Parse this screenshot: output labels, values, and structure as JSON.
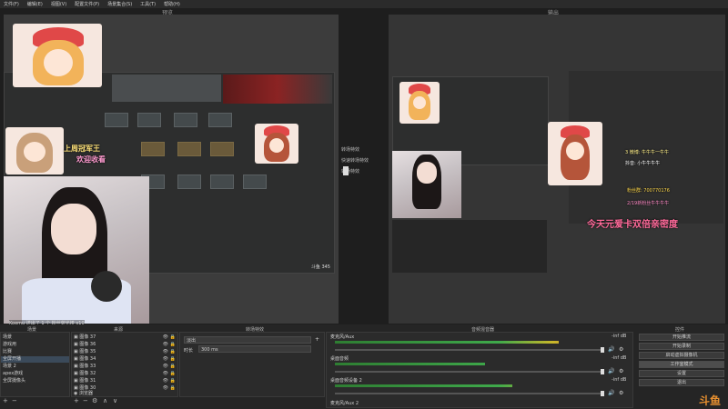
{
  "menu": [
    "文件(F)",
    "编辑(E)",
    "视图(V)",
    "配置文件(P)",
    "场景集合(S)",
    "工具(T)",
    "帮助(H)"
  ],
  "panels": {
    "preview_title": "预览",
    "output_title": "输出"
  },
  "transition_middle": {
    "btn1": "转场特效",
    "btn2": "快速转场特效",
    "btn3": "转场特效"
  },
  "overlay": {
    "sticker1": "上周冠军王",
    "sticker2": "欢迎收看",
    "output_line1": "今天元爱卡双倍亲密度",
    "weibo": "3 微博: 牛牛牛一牛牛",
    "douyin": "抖音: 小牛牛牛牛",
    "group": "粉丝群: 700770176",
    "small_text": "斗鱼 345",
    "small_text2": "2/19新粉丝牛牛牛牛"
  },
  "chat_line": "Koemu 送出了 1 个 粉丝荧光棒 x10",
  "scenes": {
    "title": "场景",
    "items": [
      "场景",
      "游戏用",
      "比赛",
      "全屏开播",
      "场景 2",
      "apex游戏",
      "全屏摄像头"
    ],
    "selected_index": 3
  },
  "sources": {
    "title": "来源",
    "items": [
      "图像 37",
      "图像 36",
      "图像 35",
      "图像 34",
      "图像 33",
      "图像 32",
      "图像 31",
      "图像 30",
      "浏览器"
    ]
  },
  "transitions": {
    "title": "转场特效",
    "type": "淡出",
    "duration_label": "时长",
    "duration_value": "300 ms"
  },
  "mixer": {
    "title": "音频混音器",
    "channels": [
      {
        "name": "麦克风/Aux",
        "db": "-inf dB",
        "level": 0.82
      },
      {
        "name": "桌面音频",
        "db": "-inf dB",
        "level": 0.55
      },
      {
        "name": "桌面音频设备 2",
        "db": "-inf dB",
        "level": 0.65
      },
      {
        "name": "麦克风/Aux 2",
        "db": "-inf dB",
        "level": 0.3
      }
    ]
  },
  "controls": {
    "title": "控件",
    "buttons": [
      "开始推流",
      "开始录制",
      "启动虚拟摄像机",
      "工作室模式",
      "设置",
      "退出"
    ],
    "active_index": 3
  },
  "watermark": "斗鱼",
  "colors": {
    "bg": "#1e1e1e",
    "dock": "#2b2b2b",
    "accent_red": "#e44848",
    "meter_green": "#3fa94b"
  }
}
